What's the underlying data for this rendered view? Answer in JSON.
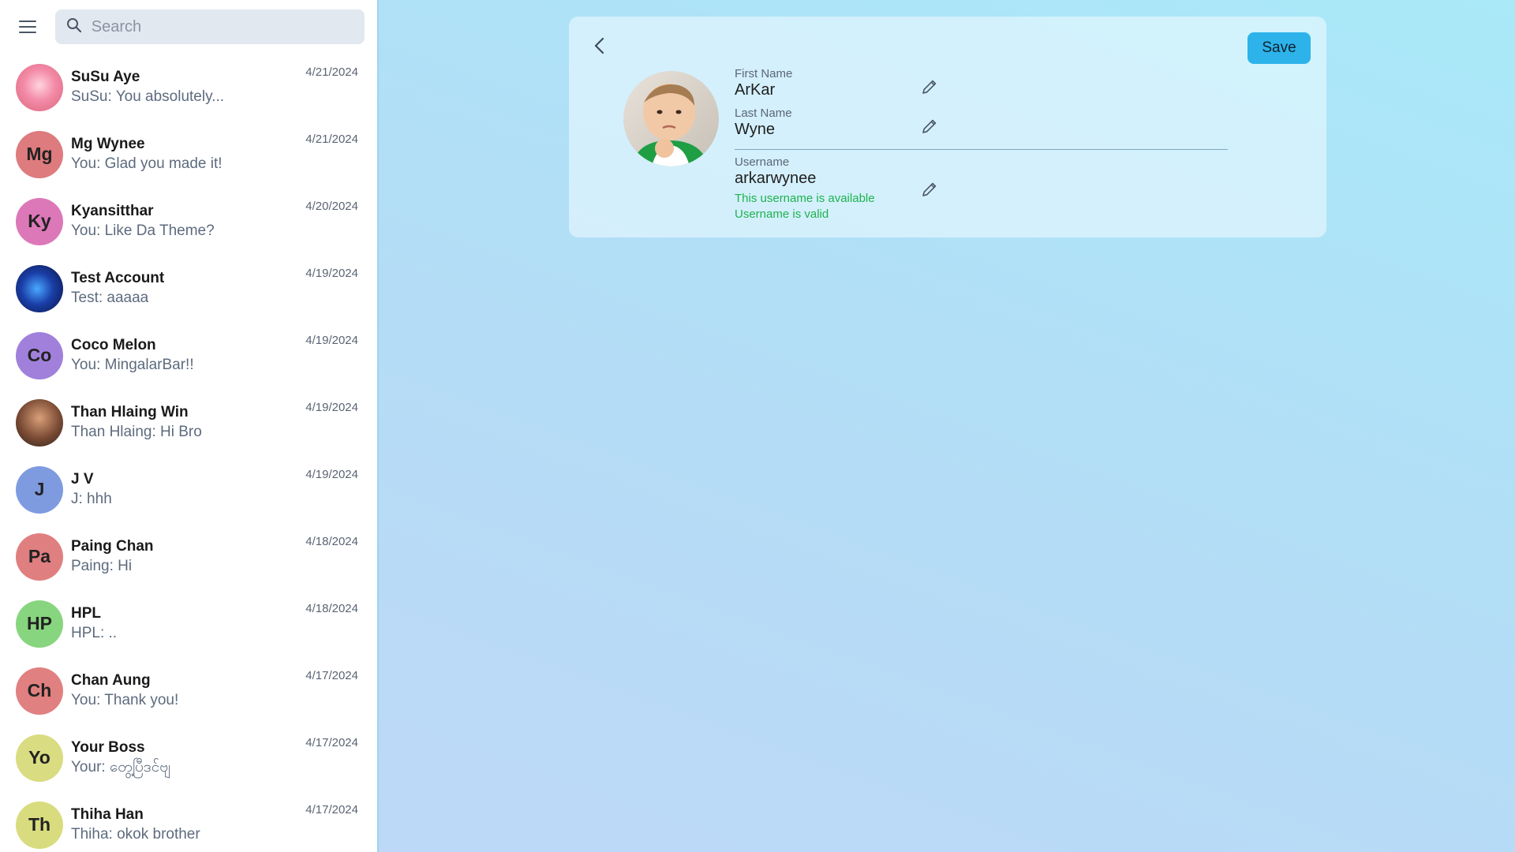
{
  "search": {
    "placeholder": "Search"
  },
  "icons": {
    "menu": "menu-icon",
    "search": "search-icon",
    "back": "chevron-left-icon",
    "edit": "pencil-icon"
  },
  "chats": [
    {
      "initials": "",
      "name": "SuSu Aye",
      "message": "SuSu: You absolutely...",
      "date": "4/21/2024",
      "avatar_type": "photo"
    },
    {
      "initials": "Mg",
      "name": "Mg Wynee",
      "message": "You: Glad you made it!",
      "date": "4/21/2024",
      "color": "#dd7b7e"
    },
    {
      "initials": "Ky",
      "name": "Kyansitthar",
      "message": "You: Like Da Theme?",
      "date": "4/20/2024",
      "color": "#dc78b8"
    },
    {
      "initials": "",
      "name": "Test Account",
      "message": "Test: aaaaa",
      "date": "4/19/2024",
      "avatar_type": "photo"
    },
    {
      "initials": "Co",
      "name": "Coco Melon",
      "message": "You: MingalarBar!!",
      "date": "4/19/2024",
      "color": "#a180dc"
    },
    {
      "initials": "",
      "name": "Than Hlaing Win",
      "message": "Than Hlaing: Hi Bro",
      "date": "4/19/2024",
      "avatar_type": "photo"
    },
    {
      "initials": "J",
      "name": "J V",
      "message": "J: hhh",
      "date": "4/19/2024",
      "color": "#7f9be0"
    },
    {
      "initials": "Pa",
      "name": "Paing Chan",
      "message": "Paing: Hi",
      "date": "4/18/2024",
      "color": "#e07f80"
    },
    {
      "initials": "HP",
      "name": "HPL",
      "message": "HPL: ..",
      "date": "4/18/2024",
      "color": "#88d57f"
    },
    {
      "initials": "Ch",
      "name": "Chan Aung",
      "message": "You: Thank you!",
      "date": "4/17/2024",
      "color": "#e08080"
    },
    {
      "initials": "Yo",
      "name": "Your Boss",
      "message": "Your: တွေ့ပြီဒင်ဗျ",
      "date": "4/17/2024",
      "color": "#d9dc80"
    },
    {
      "initials": "Th",
      "name": "Thiha Han",
      "message": "Thiha: okok brother",
      "date": "4/17/2024",
      "color": "#d8dc7e"
    }
  ],
  "profile": {
    "save_label": "Save",
    "first_name_label": "First Name",
    "first_name": "ArKar",
    "last_name_label": "Last Name",
    "last_name": "Wyne",
    "username_label": "Username",
    "username": "arkarwynee",
    "status_available": "This username is available",
    "status_valid": "Username is valid"
  },
  "colors": {
    "accent": "#2db3ea",
    "success": "#1db34e",
    "sidebar_border": "#9ad4ee"
  }
}
